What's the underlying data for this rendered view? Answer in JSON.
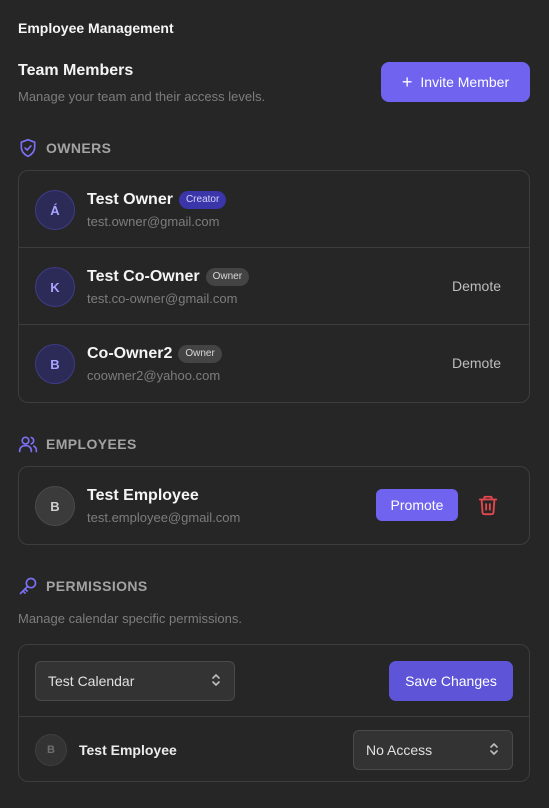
{
  "app": {
    "title": "Employee Management"
  },
  "team": {
    "title": "Team Members",
    "subtitle": "Manage your team and their access levels.",
    "invite_label": "Invite Member"
  },
  "owners": {
    "heading": "OWNERS",
    "members": [
      {
        "initial": "Á",
        "name": "Test Owner",
        "badge": "Creator",
        "email": "test.owner@gmail.com"
      },
      {
        "initial": "K",
        "name": "Test Co-Owner",
        "badge": "Owner",
        "email": "test.co-owner@gmail.com",
        "action": "Demote"
      },
      {
        "initial": "B",
        "name": "Co-Owner2",
        "badge": "Owner",
        "email": "coowner2@yahoo.com",
        "action": "Demote"
      }
    ]
  },
  "employees": {
    "heading": "EMPLOYEES",
    "members": [
      {
        "initial": "B",
        "name": "Test Employee",
        "email": "test.employee@gmail.com",
        "action": "Promote"
      }
    ]
  },
  "permissions": {
    "heading": "PERMISSIONS",
    "subtitle": "Manage calendar specific permissions.",
    "calendar_select": "Test Calendar",
    "save_label": "Save Changes",
    "rows": [
      {
        "initial": "B",
        "name": "Test Employee",
        "access": "No Access"
      }
    ]
  },
  "colors": {
    "background": "#262626",
    "accent": "#6f63f0",
    "danger": "#e5484d",
    "border": "#3d3d3d"
  }
}
